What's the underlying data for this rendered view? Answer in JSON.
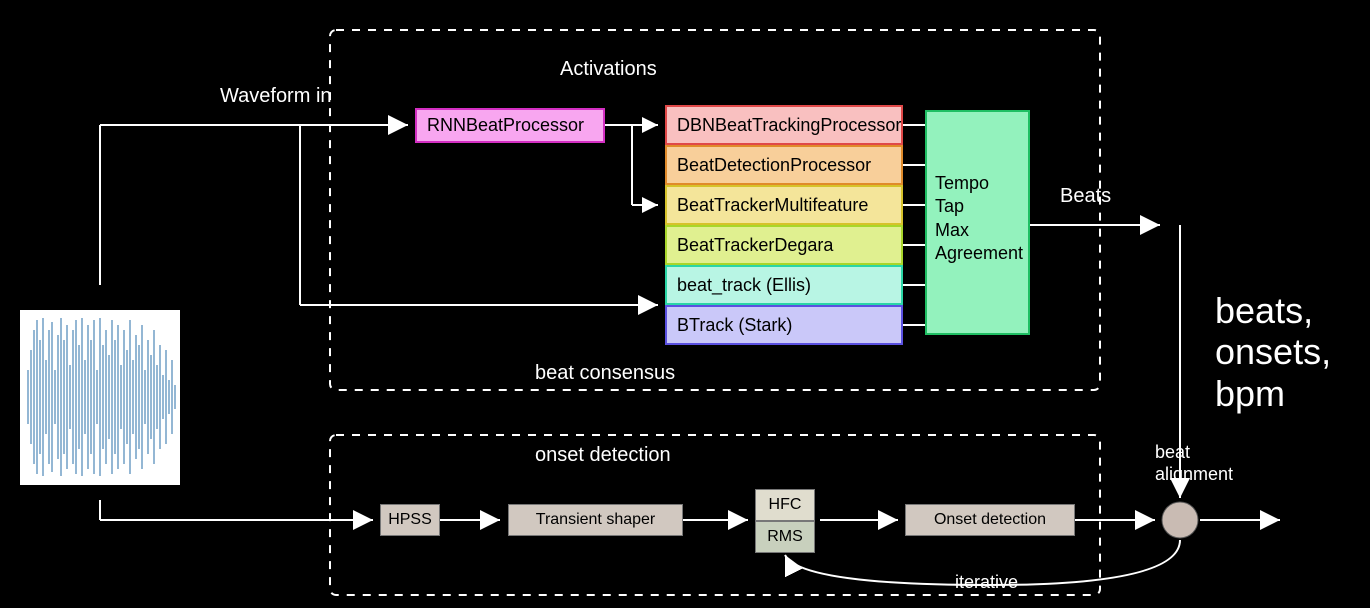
{
  "labels": {
    "waveform_in": "Waveform in",
    "activations": "Activations",
    "beats": "Beats",
    "beat_consensus": "beat consensus",
    "onset_detection": "onset detection",
    "iterative": "iterative",
    "beat_alignment": "beat alignment",
    "beats_out": "beats, onsets, bpm"
  },
  "boxes": {
    "rnn": "RNNBeatProcessor",
    "dbn": "DBNBeatTrackingProcessor",
    "bdp": "BeatDetectionProcessor",
    "btmf": "BeatTrackerMultifeature",
    "btd": "BeatTrackerDegara",
    "ellis": "beat_track (Ellis)",
    "btrack": "BTrack (Stark)",
    "ttma1": "Tempo",
    "ttma2": "Tap",
    "ttma3": "Max",
    "ttma4": "Agreement",
    "hpss": "HPSS",
    "transient": "Transient shaper",
    "hfc": "HFC",
    "rms": "RMS",
    "onset": "Onset detection"
  }
}
